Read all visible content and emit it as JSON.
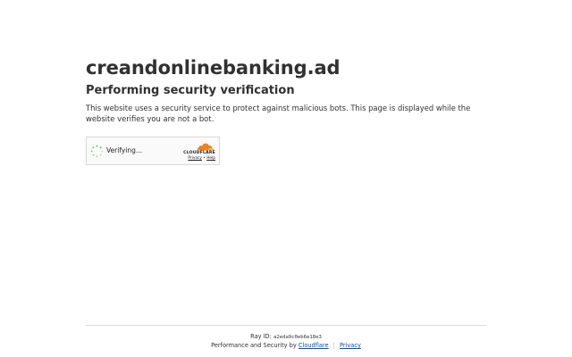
{
  "page": {
    "site_title": "creandonlinebanking.ad",
    "subtitle": "Performing security verification",
    "description": "This website uses a security service to protect against malicious bots. This page is displayed while the website verifies you are not a bot."
  },
  "widget": {
    "status_label": "Verifying...",
    "brand": "CLOUDFLARE",
    "privacy_link": "Privacy",
    "link_separator": "•",
    "help_link": "Help"
  },
  "footer": {
    "ray_label": "Ray ID:",
    "ray_value": "a2eda9c0eb6e18e3",
    "performance_text": "Performance and Security by",
    "cloudflare_link": "Cloudflare",
    "separator": "|",
    "privacy_link": "Privacy"
  },
  "colors": {
    "text": "#313131",
    "link": "#0051c3",
    "cloudflare_orange": "#f38020",
    "cloudflare_light_orange": "#fbad41",
    "spinner": "#3ca84b",
    "widget_border": "#d9d9d9"
  },
  "icons": [
    "spinner-icon",
    "cloudflare-cloud-icon"
  ]
}
